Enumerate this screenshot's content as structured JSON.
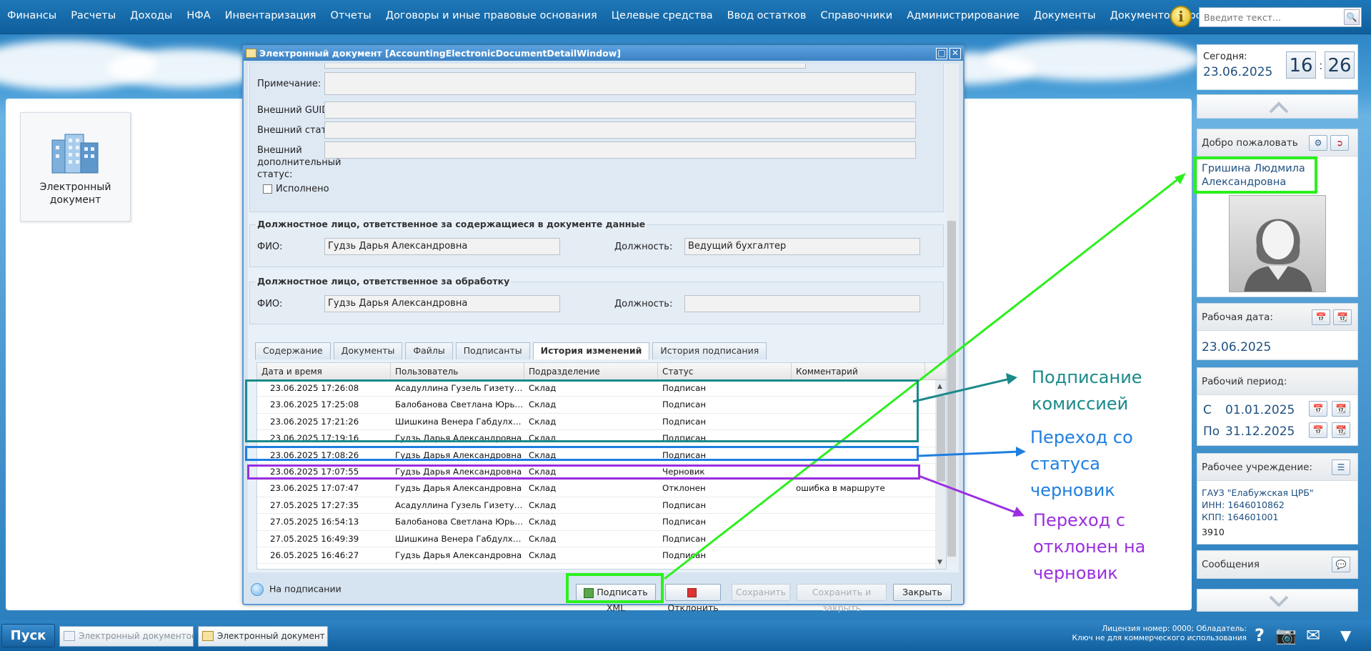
{
  "menu": [
    "Финансы",
    "Расчеты",
    "Доходы",
    "НФА",
    "Инвентаризация",
    "Отчеты",
    "Договоры и иные правовые основания",
    "Целевые средства",
    "Ввод остатков",
    "Справочники",
    "Администрирование",
    "Документы",
    "Документооборот"
  ],
  "search": {
    "placeholder": "Введите текст..."
  },
  "desktop_tile": {
    "label": "Электронный документ"
  },
  "right_panel": {
    "today_label": "Сегодня:",
    "today_date": "23.06.2025",
    "hours": "16",
    "minutes": "26",
    "welcome_label": "Добро пожаловать",
    "user_name": "Гришина Людмила Александровна",
    "work_date_label": "Рабочая дата:",
    "work_date": "23.06.2025",
    "period_label": "Рабочий период:",
    "period_from_prefix": "С",
    "period_from": "01.01.2025",
    "period_to_prefix": "По",
    "period_to": "31.12.2025",
    "institution_label": "Рабочее учреждение:",
    "institution_name": "ГАУЗ \"Елабужская ЦРБ\"",
    "inn": "ИНН: 1646010862",
    "kpp": "КПП: 164601001",
    "code": "3910",
    "messages_label": "Сообщения"
  },
  "dialog": {
    "title": "Электронный документ [AccountingElectronicDocumentDetailWindow]",
    "fields": {
      "note_label": "Примечание:",
      "ext_guid_label": "Внешний GUID:",
      "ext_status_label": "Внешний статус:",
      "ext_add_status_label": "Внешний дополнительный статус:",
      "done_label": "Исполнено"
    },
    "responsible_data": {
      "legend": "Должностное лицо, ответственное за содержащиеся в документе данные",
      "fio_label": "ФИО:",
      "fio": "Гудзь Дарья Александровна",
      "position_label": "Должность:",
      "position": "Ведущий бухгалтер"
    },
    "responsible_processing": {
      "legend": "Должностное лицо, ответственное за обработку",
      "fio_label": "ФИО:",
      "fio": "Гудзь Дарья Александровна",
      "position_label": "Должность:",
      "position": ""
    },
    "tabs": [
      "Содержание",
      "Документы",
      "Файлы",
      "Подписанты",
      "История изменений",
      "История подписания"
    ],
    "active_tab": "История изменений",
    "grid": {
      "columns": [
        "Дата и время",
        "Пользователь",
        "Подразделение",
        "Статус",
        "Комментарий"
      ],
      "rows": [
        [
          "23.06.2025 17:26:08",
          "Асадуллина Гузель Гизетулл...",
          "Склад",
          "Подписан",
          ""
        ],
        [
          "23.06.2025 17:25:08",
          "Балобанова Светлана Юрье...",
          "Склад",
          "Подписан",
          ""
        ],
        [
          "23.06.2025 17:21:26",
          "Шишкина Венера Габдулхае...",
          "Склад",
          "Подписан",
          ""
        ],
        [
          "23.06.2025 17:19:16",
          "Гудзь Дарья Александровна",
          "Склад",
          "Подписан",
          ""
        ],
        [
          "23.06.2025 17:08:26",
          "Гудзь Дарья Александровна",
          "Склад",
          "Подписан",
          ""
        ],
        [
          "23.06.2025 17:07:55",
          "Гудзь Дарья Александровна",
          "Склад",
          "Черновик",
          ""
        ],
        [
          "23.06.2025 17:07:47",
          "Гудзь Дарья Александровна",
          "Склад",
          "Отклонен",
          "ошибка в маршруте"
        ],
        [
          "27.05.2025 17:27:35",
          "Асадуллина Гузель Гизетулл...",
          "Склад",
          "Подписан",
          ""
        ],
        [
          "27.05.2025 16:54:13",
          "Балобанова Светлана Юрье...",
          "Склад",
          "Подписан",
          ""
        ],
        [
          "27.05.2025 16:49:39",
          "Шишкина Венера Габдулхае...",
          "Склад",
          "Подписан",
          ""
        ],
        [
          "26.05.2025 16:46:27",
          "Гудзь Дарья Александровна",
          "Склад",
          "Подписан",
          ""
        ],
        [
          "",
          "",
          "",
          "",
          ""
        ]
      ]
    },
    "state_text": "На подписании",
    "buttons": {
      "sign_xml": "Подписать XML",
      "reject": "Отклонить",
      "save": "Сохранить",
      "save_close": "Сохранить и закрыть",
      "close": "Закрыть"
    }
  },
  "annotations": {
    "commission": "Подписание комиссией",
    "from_draft": "Переход со статуса черновик",
    "from_rejected": "Переход с отклонен на черновик",
    "colors": {
      "teal": "#1a8a8a",
      "blue": "#1e7fe0",
      "purple": "#9b2fe0",
      "green": "#2cf01e"
    }
  },
  "taskbar": {
    "start": "Пуск",
    "items": [
      "Электронный документоо...",
      "Электронный документ [..."
    ],
    "license_line1": "Лицензия номер: 0000; Обладатель:",
    "license_line2": "Ключ не для коммерческого использования"
  }
}
